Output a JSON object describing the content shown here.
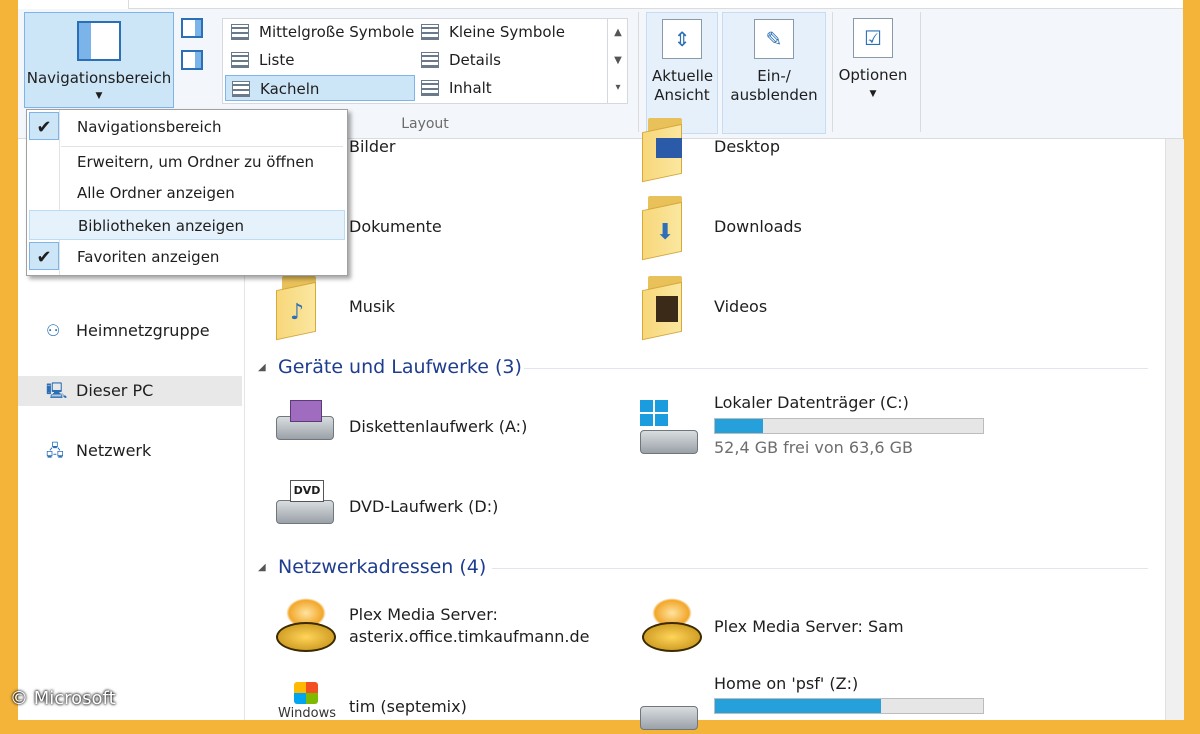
{
  "ribbon": {
    "navigation_pane_label": "Navigationsbereich",
    "layout_items": [
      {
        "label": "Mittelgroße Symbole"
      },
      {
        "label": "Kleine Symbole"
      },
      {
        "label": "Liste"
      },
      {
        "label": "Details"
      },
      {
        "label": "Kacheln"
      },
      {
        "label": "Inhalt"
      }
    ],
    "layout_group_label": "Layout",
    "current_view_label": "Aktuelle Ansicht",
    "show_hide_label_line1": "Ein-/",
    "show_hide_label_line2": "ausblenden",
    "options_label": "Optionen"
  },
  "menu": {
    "items": [
      {
        "label": "Navigationsbereich",
        "checked": true
      },
      {
        "label": "Erweitern, um Ordner zu öffnen",
        "checked": false
      },
      {
        "label": "Alle Ordner anzeigen",
        "checked": false
      },
      {
        "label": "Bibliotheken anzeigen",
        "checked": false
      },
      {
        "label": "Favoriten anzeigen",
        "checked": true
      }
    ]
  },
  "sidebar": {
    "items": [
      {
        "label": "Heimnetzgruppe",
        "icon": "homegroup-icon"
      },
      {
        "label": "Dieser PC",
        "icon": "computer-icon"
      },
      {
        "label": "Netzwerk",
        "icon": "network-icon"
      }
    ]
  },
  "folders": [
    {
      "label": "Bilder"
    },
    {
      "label": "Desktop"
    },
    {
      "label": "Dokumente"
    },
    {
      "label": "Downloads"
    },
    {
      "label": "Musik"
    },
    {
      "label": "Videos"
    }
  ],
  "devices": {
    "heading": "Geräte und Laufwerke (3)",
    "items": [
      {
        "label": "Diskettenlaufwerk (A:)"
      },
      {
        "label": "Lokaler Datenträger (C:)",
        "detail": "52,4 GB frei von 63,6 GB",
        "used_fraction": 0.18
      },
      {
        "label": "DVD-Laufwerk (D:)",
        "badge": "DVD"
      }
    ]
  },
  "network": {
    "heading": "Netzwerkadressen (4)",
    "items": [
      {
        "label_line1": "Plex Media Server:",
        "label_line2": "asterix.office.timkaufmann.de"
      },
      {
        "label": "Plex Media Server: Sam"
      },
      {
        "label": "tim (septemix)",
        "logo_text": "Windows"
      },
      {
        "label": "Home on 'psf' (Z:)",
        "used_fraction": 0.62
      }
    ]
  },
  "watermark": "© Microsoft",
  "colors": {
    "accent": "#2b6fb6",
    "heading": "#1e3d8f",
    "bar_fill": "#26a0da",
    "frame": "#f4b43a"
  }
}
